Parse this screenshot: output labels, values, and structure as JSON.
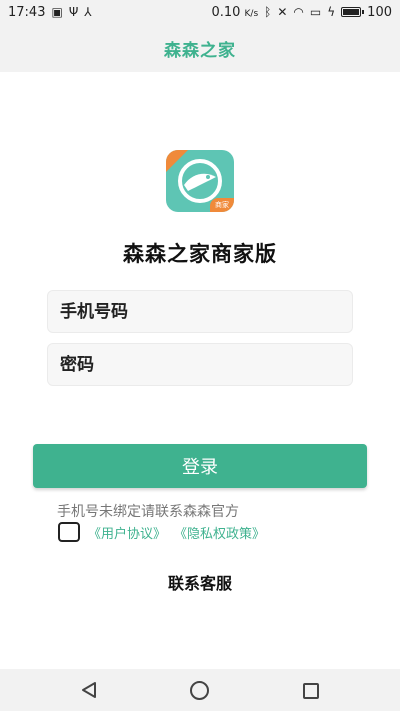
{
  "status_bar": {
    "time": "17:43",
    "speed": "0.10",
    "speed_unit": "K/s",
    "battery_level": "100",
    "battery_fraction": 1.0,
    "left_icons": [
      "image-icon",
      "usb-icon",
      "share-icon"
    ],
    "right_icons": [
      "bluetooth-icon",
      "mute-icon",
      "wifi-icon",
      "sim-icon",
      "charging-icon",
      "battery-icon"
    ]
  },
  "header": {
    "title": "森森之家"
  },
  "logo": {
    "badge_text": "商家"
  },
  "main": {
    "brand_title": "森森之家商家版",
    "phone_placeholder": "手机号码",
    "password_placeholder": "密码",
    "login_label": "登录",
    "hint": "手机号未绑定请联系森森官方",
    "user_agreement": "《用户协议》",
    "privacy_policy": "《隐私权政策》",
    "contact_service": "联系客服"
  },
  "colors": {
    "accent": "#3fb28f",
    "logo_bg": "#5ec5b4",
    "logo_accent": "#f08a3a"
  }
}
